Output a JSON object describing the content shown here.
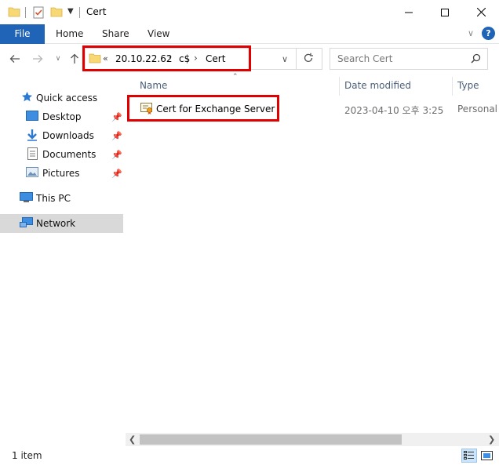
{
  "window": {
    "title": "Cert"
  },
  "ribbon": {
    "tabs": [
      "File",
      "Home",
      "Share",
      "View"
    ]
  },
  "address": {
    "overflow": "«",
    "segments": [
      "20.10.22.62",
      "c$",
      "Cert"
    ],
    "separator": "›"
  },
  "search": {
    "placeholder": "Search Cert"
  },
  "nav": {
    "quick_access": "Quick access",
    "items": [
      {
        "label": "Desktop",
        "pinned": true
      },
      {
        "label": "Downloads",
        "pinned": true
      },
      {
        "label": "Documents",
        "pinned": true
      },
      {
        "label": "Pictures",
        "pinned": true
      }
    ],
    "this_pc": "This PC",
    "network": "Network"
  },
  "columns": {
    "name": "Name",
    "date_modified": "Date modified",
    "type": "Type"
  },
  "files": [
    {
      "name": "Cert for Exchange Server",
      "date_modified": "2023-04-10 오후 3:25",
      "type": "Personal I"
    }
  ],
  "status": {
    "item_count": "1 item"
  },
  "colors": {
    "accent": "#1f64b6",
    "highlight": "#e00000",
    "nav_selected": "#d9d9d9"
  }
}
